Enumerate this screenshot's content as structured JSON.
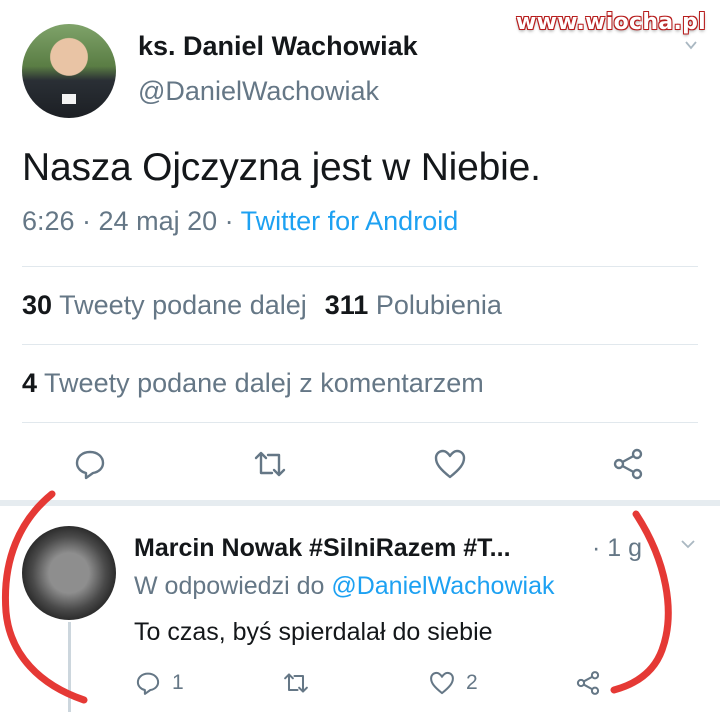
{
  "watermark": "www.wiocha.pl",
  "tweet": {
    "author_name": "ks. Daniel Wachowiak",
    "author_handle": "@DanielWachowiak",
    "text": "Nasza Ojczyzna jest w Niebie.",
    "timestamp": "6:26 · 24 maj 20 · ",
    "source": "Twitter for Android",
    "retweets_count": "30",
    "retweets_label": "Tweety podane dalej",
    "likes_count": "311",
    "likes_label": "Polubienia",
    "quotes_count": "4",
    "quotes_label": "Tweety podane dalej z komentarzem",
    "actions": [
      "reply-icon",
      "retweet-icon",
      "like-icon",
      "share-icon"
    ]
  },
  "reply": {
    "author_name": "Marcin Nowak #SilniRazem #T...",
    "time": "· 1 g",
    "replying_to_prefix": "W odpowiedzi do ",
    "replying_to_handle": "@DanielWachowiak",
    "text": "To czas, byś spierdalał do siebie",
    "reply_count": "1",
    "like_count": "2"
  },
  "colors": {
    "accent": "#1da1f2",
    "secondary_text": "#657786",
    "primary_text": "#14171a",
    "annotation_red": "#e53935"
  }
}
